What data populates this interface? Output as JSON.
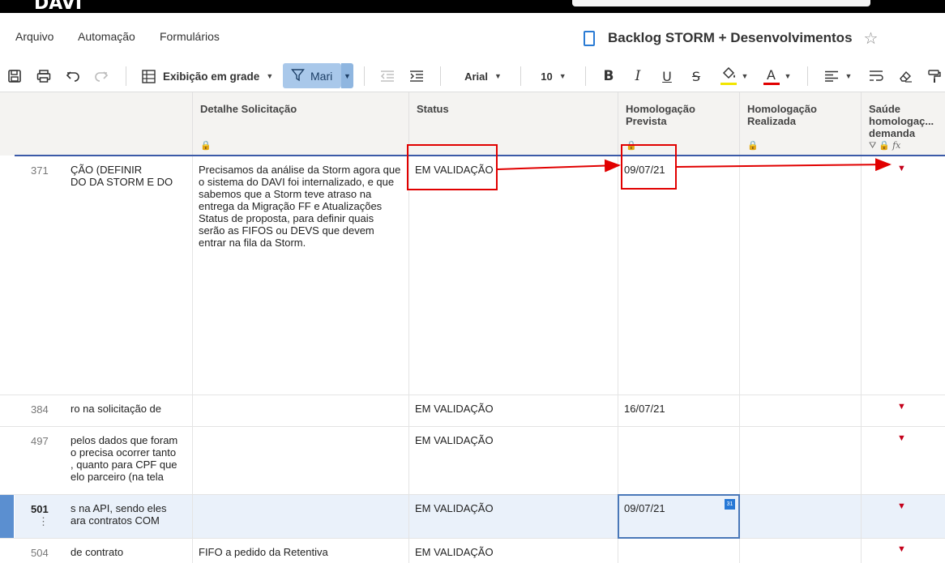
{
  "brand": {
    "logo_text": "DAVI"
  },
  "menu": {
    "items": [
      "Arquivo",
      "Automação",
      "Formulários"
    ]
  },
  "document": {
    "title": "Backlog STORM + Desenvolvimentos"
  },
  "toolbar": {
    "view_label": "Exibição em grade",
    "filter_label": "Mari",
    "font_name": "Arial",
    "font_size": "10",
    "icons": [
      "save-icon",
      "print-icon",
      "undo-icon",
      "redo-icon",
      "grid-view-icon",
      "filter-icon",
      "outdent-icon",
      "indent-icon",
      "bold-icon",
      "italic-icon",
      "underline-icon",
      "strikethrough-icon",
      "fill-color-icon",
      "text-color-icon",
      "align-left-icon",
      "wrap-text-icon",
      "clear-format-icon",
      "paint-format-icon"
    ],
    "colors": {
      "filter_bg": "#a9c8ea",
      "fill_underline": "#f2e500",
      "text_color_underline": "#e10000"
    }
  },
  "columns": {
    "detail": "Detalhe Solicitação",
    "status": "Status",
    "homolog_prevista": "Homologação Prevista",
    "homolog_realizada": "Homologação Realizada",
    "saude": "Saúde homologaç... demanda"
  },
  "rows": [
    {
      "num": "371",
      "name": "ÇÃO (DEFINIR\nDO DA STORM E DO",
      "detail": "Precisamos da análise da Storm agora que o sistema do DAVI foi internalizado, e que sabemos que a Storm teve atraso na entrega da Migração FF e Atualizações Status de proposta, para definir quais serão as FIFOS ou DEVS que devem entrar na fila da Storm.",
      "status": "EM VALIDAÇÃO",
      "prevista": "09/07/21",
      "realizada": ""
    },
    {
      "num": "384",
      "name": "ro na solicitação de",
      "detail": "",
      "status": "EM VALIDAÇÃO",
      "prevista": "16/07/21",
      "realizada": ""
    },
    {
      "num": "497",
      "name": "pelos dados que foram\no precisa ocorrer tanto\n, quanto para CPF que\nelo parceiro (na tela",
      "detail": "",
      "status": "EM VALIDAÇÃO",
      "prevista": "",
      "realizada": ""
    },
    {
      "num": "501",
      "name": "s na API, sendo eles\nara contratos COM",
      "detail": "",
      "status": "EM VALIDAÇÃO",
      "prevista": "09/07/21",
      "realizada": ""
    },
    {
      "num": "504",
      "name": "de contrato",
      "detail": "FIFO a pedido da Retentiva",
      "status": "EM VALIDAÇÃO",
      "prevista": "",
      "realizada": ""
    }
  ],
  "date_picker_icon": "31"
}
